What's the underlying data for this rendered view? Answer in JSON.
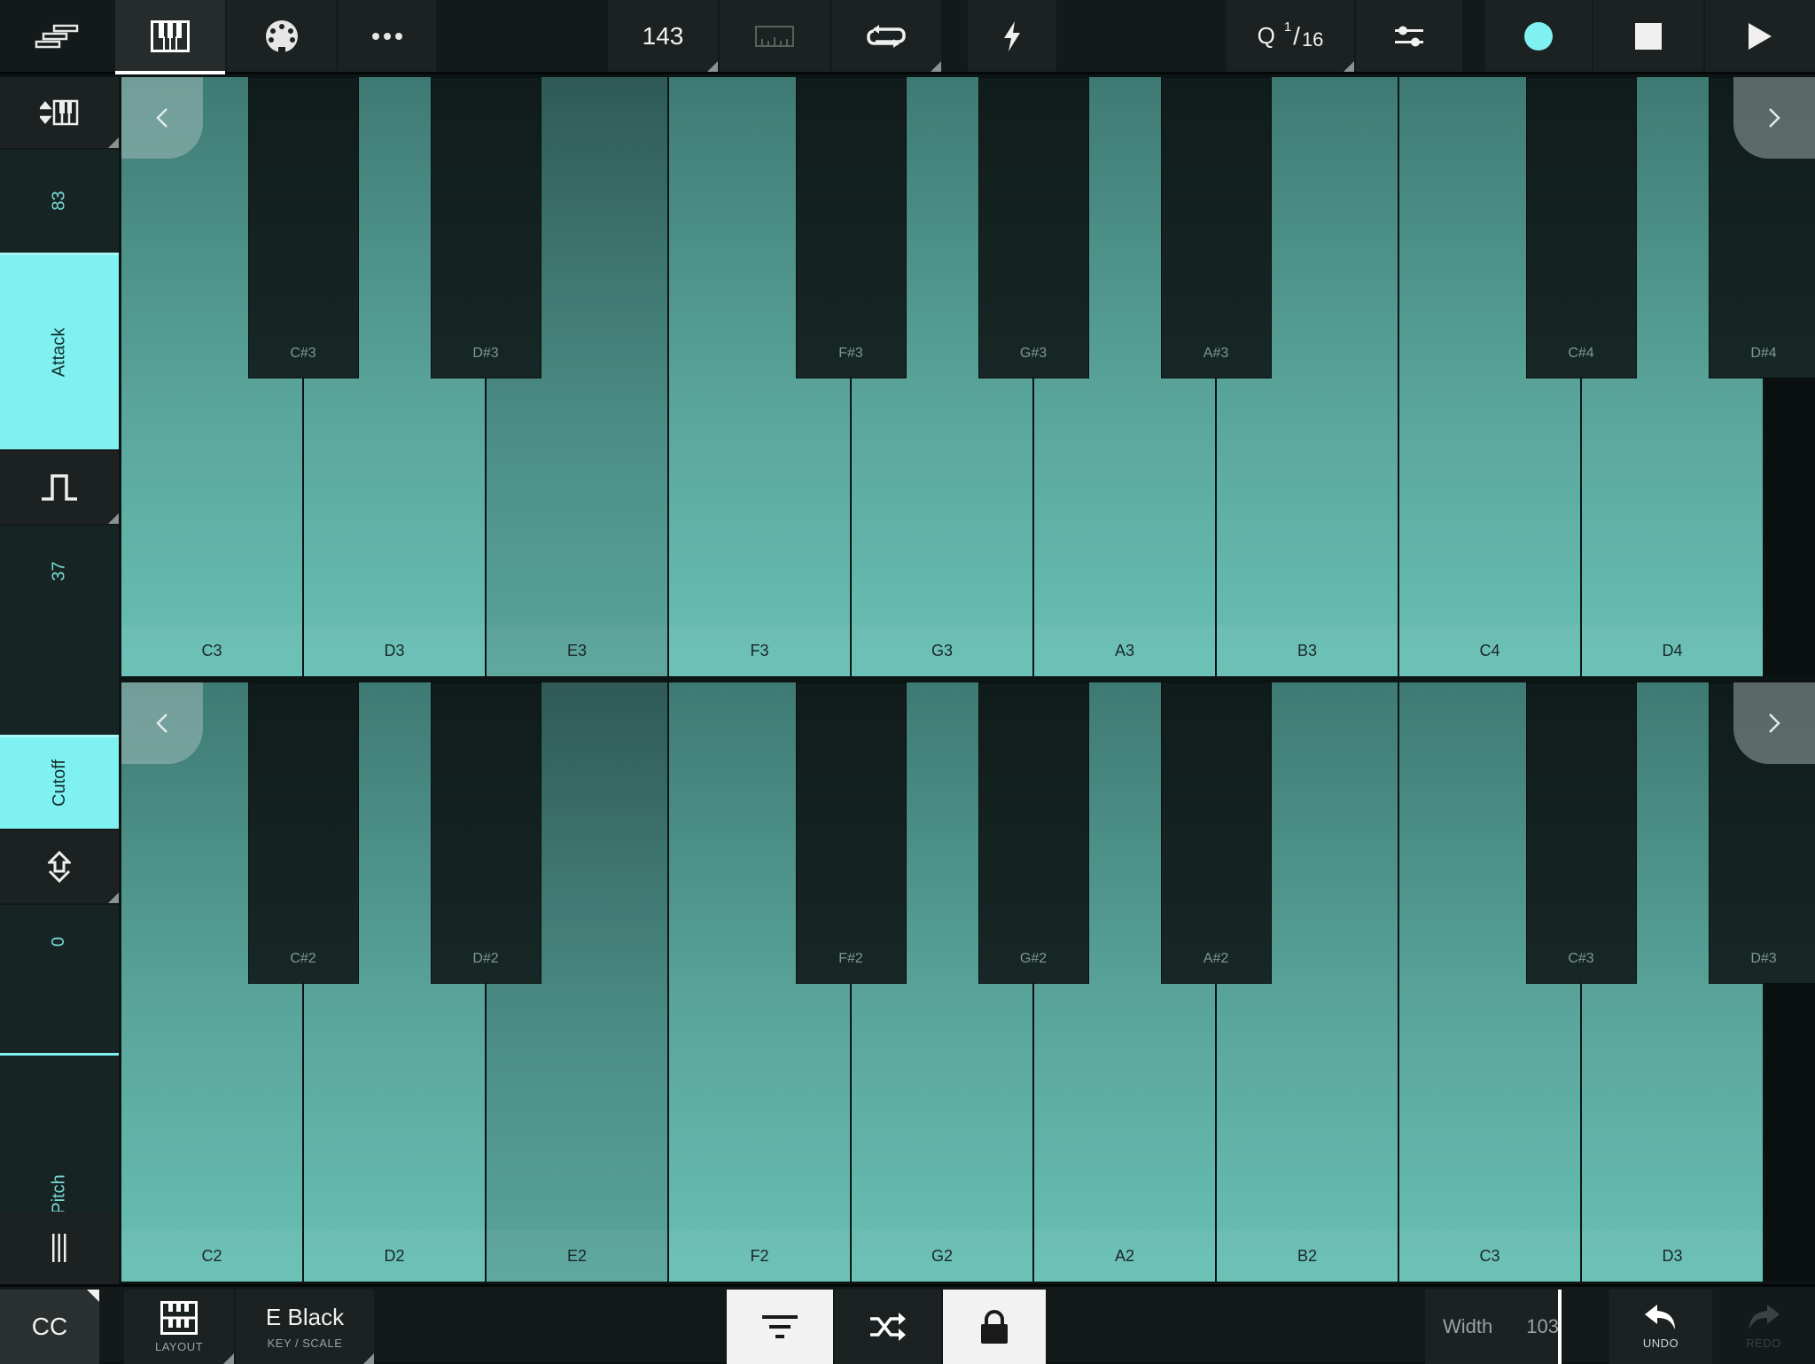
{
  "app": {
    "accent_color": "#7ff1f1"
  },
  "topbar": {
    "menu_icon": "sequencer-menu-icon",
    "tabs": [
      {
        "icon": "piano-keys-icon",
        "selected": true
      },
      {
        "icon": "midi-port-icon",
        "selected": false
      },
      {
        "icon": "more-dots-icon",
        "selected": false
      }
    ],
    "tempo": "143",
    "metronome_icon": "ruler-metronome-icon",
    "loop_icon": "loop-icon",
    "quick_icon": "lightning-icon",
    "quantize": {
      "prefix": "Q",
      "numerator": "1",
      "denominator": "16"
    },
    "routing_icon": "routing-toggle-icon",
    "record_color": "#7ff1f1",
    "stop_icon": "stop-icon",
    "play_icon": "play-icon"
  },
  "sidebar": {
    "top_value": "83",
    "top_label": "Attack",
    "mid_value": "37",
    "mid_label": "Cutoff",
    "bottom_value": "0",
    "bottom_label": "Pitch",
    "grip_icon": "grip-bars-icon"
  },
  "keyboards": [
    {
      "white_keys": [
        "C3",
        "D3",
        "E3",
        "F3",
        "G3",
        "A3",
        "B3",
        "C4",
        "D4"
      ],
      "black_keys": [
        "C#3",
        "D#3",
        "F#3",
        "G#3",
        "A#3",
        "C#4",
        "D#4"
      ]
    },
    {
      "white_keys": [
        "C2",
        "D2",
        "E2",
        "F2",
        "G2",
        "A2",
        "B2",
        "C3",
        "D3"
      ],
      "black_keys": [
        "C#2",
        "D#2",
        "F#2",
        "G#2",
        "A#2",
        "C#3",
        "D#3"
      ]
    }
  ],
  "bottombar": {
    "cc_label": "CC",
    "layout_label": "LAYOUT",
    "key_value": "E Black",
    "key_label": "KEY / SCALE",
    "filter_icon": "filter-lines-icon",
    "shuffle_icon": "shuffle-icon",
    "lock_icon": "lock-icon",
    "width_label": "Width",
    "width_value": "103",
    "undo_label": "UNDO",
    "redo_label": "REDO"
  }
}
